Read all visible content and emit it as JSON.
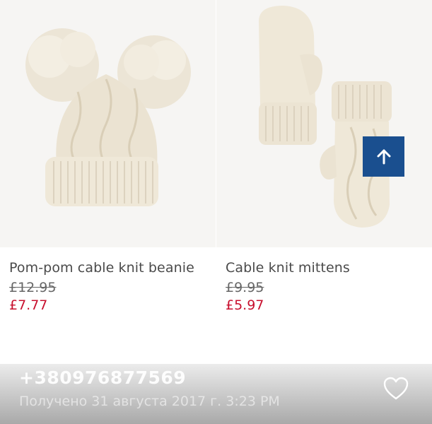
{
  "products": [
    {
      "title": "Pom-pom cable knit beanie",
      "old_price": "£12.95",
      "new_price": "£7.77",
      "image": "beanie-image"
    },
    {
      "title": "Cable knit mittens",
      "old_price": "£9.95",
      "new_price": "£5.97",
      "image": "mittens-image"
    }
  ],
  "back_to_top": {
    "icon": "arrow-up-icon",
    "color": "#1a4f8f"
  },
  "colors": {
    "sale_price": "#c8102e",
    "old_price": "#666666",
    "title": "#4a4a4a",
    "knit": "#efe8d8"
  },
  "message": {
    "sender": "+380976877569",
    "received": "Получено 31 августа 2017 г. 3:23 PM",
    "like_icon": "heart-icon"
  }
}
